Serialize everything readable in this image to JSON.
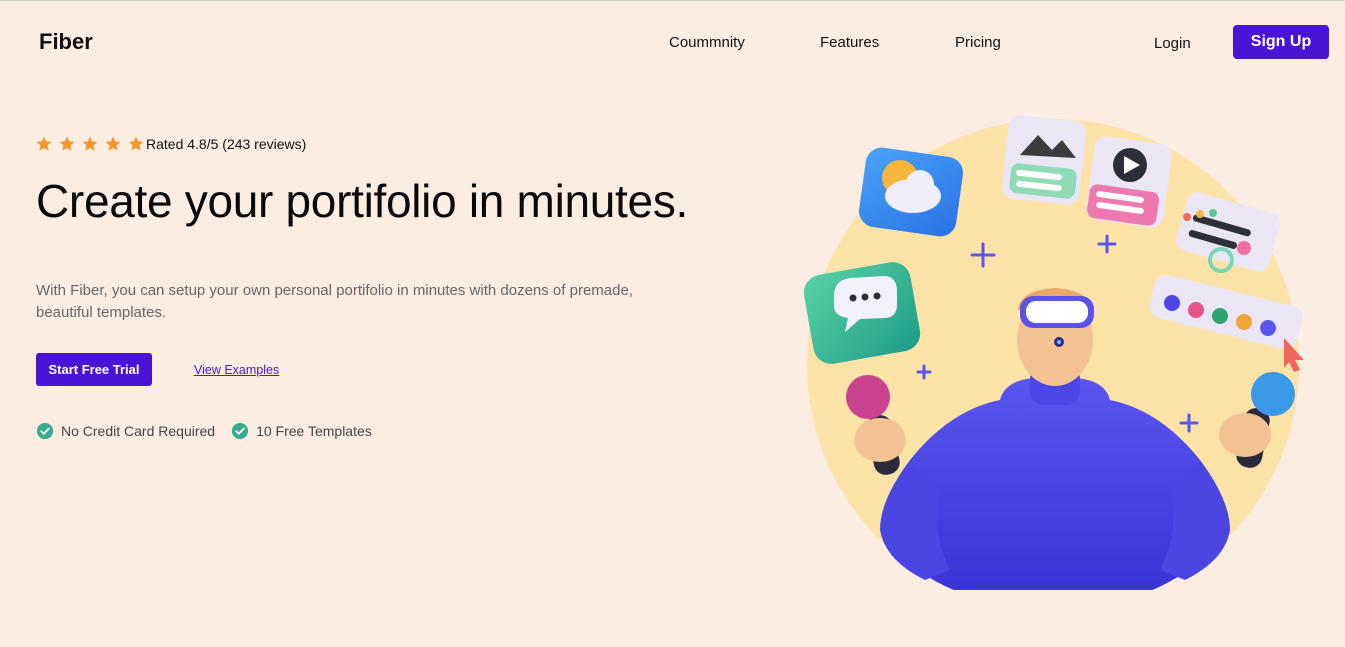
{
  "brand": {
    "name": "Fiber"
  },
  "nav": {
    "items": [
      {
        "label": "Coummnity"
      },
      {
        "label": "Features"
      },
      {
        "label": "Pricing"
      }
    ],
    "login_label": "Login",
    "signup_label": "Sign Up"
  },
  "rating": {
    "stars": 5,
    "text": "Rated 4.8/5 (243 reviews)"
  },
  "hero": {
    "headline": "Create your portifolio in minutes.",
    "description": "With Fiber, you can setup your own personal portifolio in minutes with dozens of premade, beautiful templates.",
    "cta_label": "Start Free Trial",
    "secondary_label": "View Examples"
  },
  "perks": [
    {
      "label": "No Credit Card Required",
      "icon": "check-circle-icon"
    },
    {
      "label": "10 Free Templates",
      "icon": "check-circle-icon"
    }
  ],
  "colors": {
    "accent": "#4a14d6",
    "background": "#fcede3",
    "star": "#f5962a",
    "check": "#3aab8f",
    "circle": "#fde3a7"
  }
}
